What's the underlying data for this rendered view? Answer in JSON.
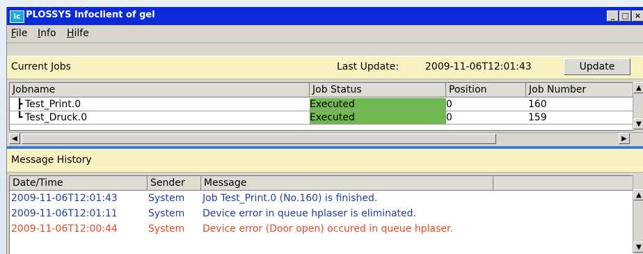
{
  "window": {
    "title": "PLOSSYS Infoclient of gel",
    "icon_text": "ic",
    "minimize_glyph": "_",
    "maximize_glyph": "□",
    "close_glyph": "×"
  },
  "menu": [
    "File",
    "Info",
    "Hilfe"
  ],
  "jobs": {
    "title": "Current Jobs",
    "last_update_label": "Last Update:",
    "last_update_value": "2009-11-06T12:01:43",
    "update_label": "Update",
    "columns": [
      "Jobname",
      "Job Status",
      "Position",
      "Job Number"
    ],
    "rows": [
      {
        "name": "Test_Print.0",
        "status": "Executed",
        "position": "0",
        "number": "160"
      },
      {
        "name": "Test_Druck.0",
        "status": "Executed",
        "position": "0",
        "number": "159"
      }
    ],
    "status_color": "#6fba50"
  },
  "history": {
    "title": "Message History",
    "columns": [
      "Date/Time",
      "Sender",
      "Message",
      ""
    ],
    "rows": [
      {
        "time": "2009-11-06T12:01:43",
        "sender": "System",
        "message": "Job Test_Print.0 (No.160) is finished.",
        "level": "info"
      },
      {
        "time": "2009-11-06T12:01:11",
        "sender": "System",
        "message": "Device error in queue hplaser is eliminated.",
        "level": "info"
      },
      {
        "time": "2009-11-06T12:00:44",
        "sender": "System",
        "message": "Device error (Door open) occured in queue hplaser.",
        "level": "error"
      }
    ],
    "info_color": "#1d3da8",
    "error_color": "#e04a24"
  }
}
